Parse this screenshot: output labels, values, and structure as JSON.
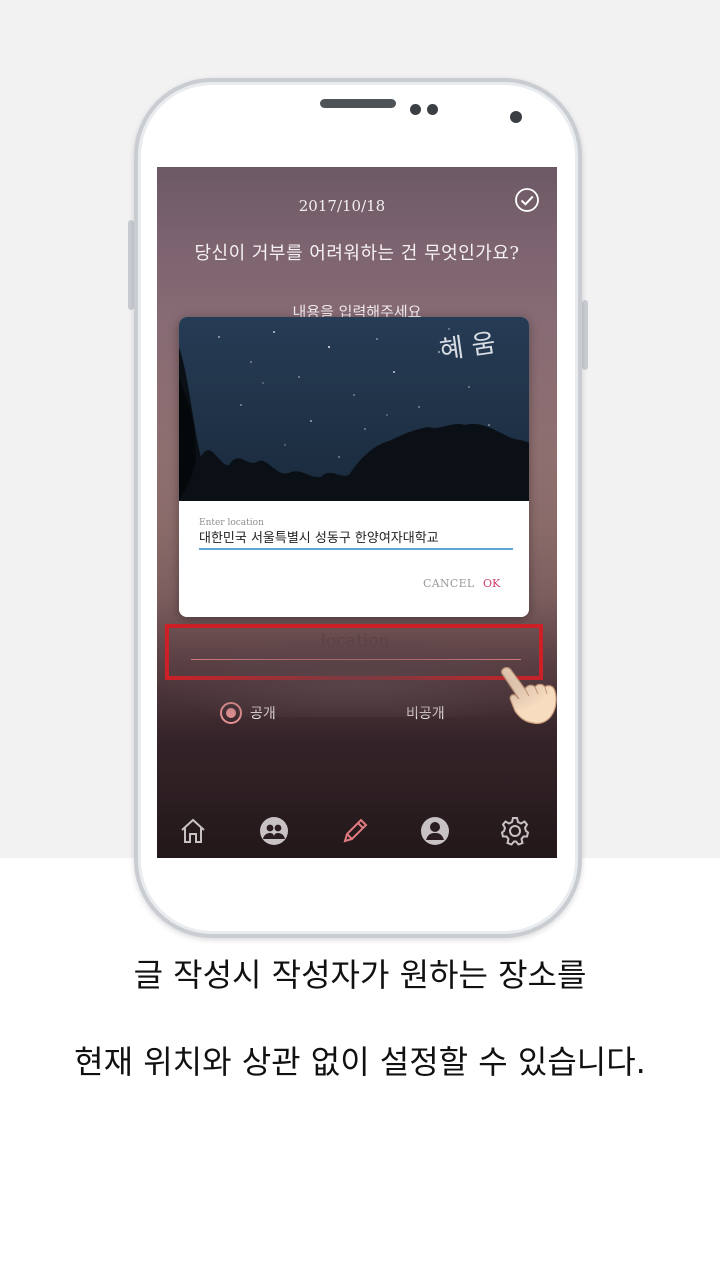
{
  "screen": {
    "date": "2017/10/18",
    "question": "당신이 거부를 어려워하는 건 무엇인가요?",
    "partially_hidden_text": "내용을 입력해주세요"
  },
  "dialog": {
    "brand_text": "혜 움",
    "location_label": "Enter location",
    "location_value": "대한민국 서울특별시 성동구 한양여자대학교",
    "cancel_label": "CANCEL",
    "ok_label": "OK"
  },
  "location_field": {
    "placeholder": "location"
  },
  "visibility": {
    "public_label": "공개",
    "private_label": "비공개"
  },
  "nav": {
    "items": [
      "home-icon",
      "friends-icon",
      "pencil-icon",
      "profile-icon",
      "gear-icon"
    ],
    "active_color": "#e07b80"
  },
  "caption": {
    "line1": "글 작성시 작성자가 원하는 장소를",
    "line2": "현재 위치와 상관 없이 설정할 수 있습니다."
  },
  "colors": {
    "highlight": "#cf1f26",
    "ok": "#d2426b",
    "input_underline": "#5fa6d1"
  }
}
